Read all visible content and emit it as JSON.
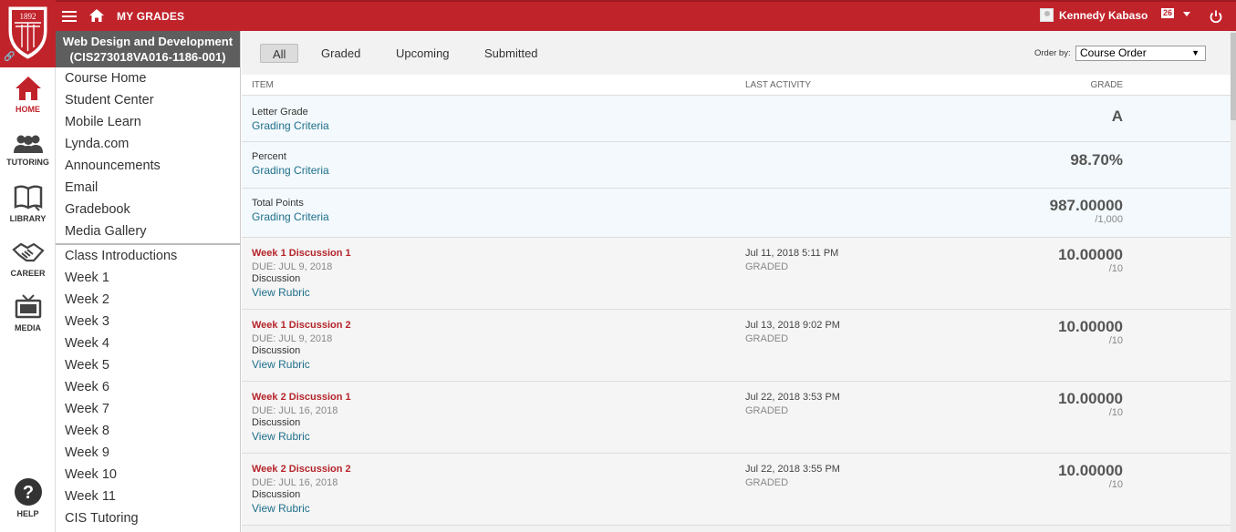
{
  "topbar": {
    "title": "MY GRADES",
    "user_name": "Kennedy Kabaso",
    "notification_count": "26"
  },
  "logo": {
    "text": "1892"
  },
  "rail": [
    {
      "label": "HOME",
      "icon": "home-icon",
      "active": true
    },
    {
      "label": "TUTORING",
      "icon": "tutoring-icon"
    },
    {
      "label": "LIBRARY",
      "icon": "library-icon"
    },
    {
      "label": "CAREER",
      "icon": "career-icon"
    },
    {
      "label": "MEDIA",
      "icon": "media-icon"
    },
    {
      "label": "HELP",
      "icon": "help-icon"
    }
  ],
  "course": {
    "title_line1": "Web Design and Development",
    "title_line2": "(CIS273018VA016-1186-001)",
    "nav_top": [
      "Course Home",
      "Student Center",
      "Mobile Learn",
      "Lynda.com",
      "Announcements",
      "Email",
      "Gradebook",
      "Media Gallery"
    ],
    "nav_bottom": [
      "Class Introductions",
      "Week 1",
      "Week 2",
      "Week 3",
      "Week 4",
      "Week 5",
      "Week 6",
      "Week 7",
      "Week 8",
      "Week 9",
      "Week 10",
      "Week 11",
      "CIS Tutoring"
    ]
  },
  "filters": {
    "all": "All",
    "graded": "Graded",
    "upcoming": "Upcoming",
    "submitted": "Submitted",
    "order_by_label": "Order by:",
    "order_by_value": "Course Order"
  },
  "table": {
    "col_item": "ITEM",
    "col_activity": "LAST ACTIVITY",
    "col_grade": "GRADE"
  },
  "summary": [
    {
      "label": "Letter Grade",
      "link": "Grading Criteria",
      "grade": "A",
      "outof": ""
    },
    {
      "label": "Percent",
      "link": "Grading Criteria",
      "grade": "98.70%",
      "outof": ""
    },
    {
      "label": "Total Points",
      "link": "Grading Criteria",
      "grade": "987.00000",
      "outof": "/1,000"
    }
  ],
  "items": [
    {
      "title": "Week 1 Discussion 1",
      "due": "DUE: JUL 9, 2018",
      "type": "Discussion",
      "rubric": "View Rubric",
      "date": "Jul 11, 2018 5:11 PM",
      "status": "GRADED",
      "grade": "10.00000",
      "outof": "/10"
    },
    {
      "title": "Week 1 Discussion 2",
      "due": "DUE: JUL 9, 2018",
      "type": "Discussion",
      "rubric": "View Rubric",
      "date": "Jul 13, 2018 9:02 PM",
      "status": "GRADED",
      "grade": "10.00000",
      "outof": "/10"
    },
    {
      "title": "Week 2 Discussion 1",
      "due": "DUE: JUL 16, 2018",
      "type": "Discussion",
      "rubric": "View Rubric",
      "date": "Jul 22, 2018 3:53 PM",
      "status": "GRADED",
      "grade": "10.00000",
      "outof": "/10"
    },
    {
      "title": "Week 2 Discussion 2",
      "due": "DUE: JUL 16, 2018",
      "type": "Discussion",
      "rubric": "View Rubric",
      "date": "Jul 22, 2018 3:55 PM",
      "status": "GRADED",
      "grade": "10.00000",
      "outof": "/10"
    }
  ],
  "colors": {
    "brand_red": "#c1232b",
    "link_teal": "#1f6f8b"
  }
}
